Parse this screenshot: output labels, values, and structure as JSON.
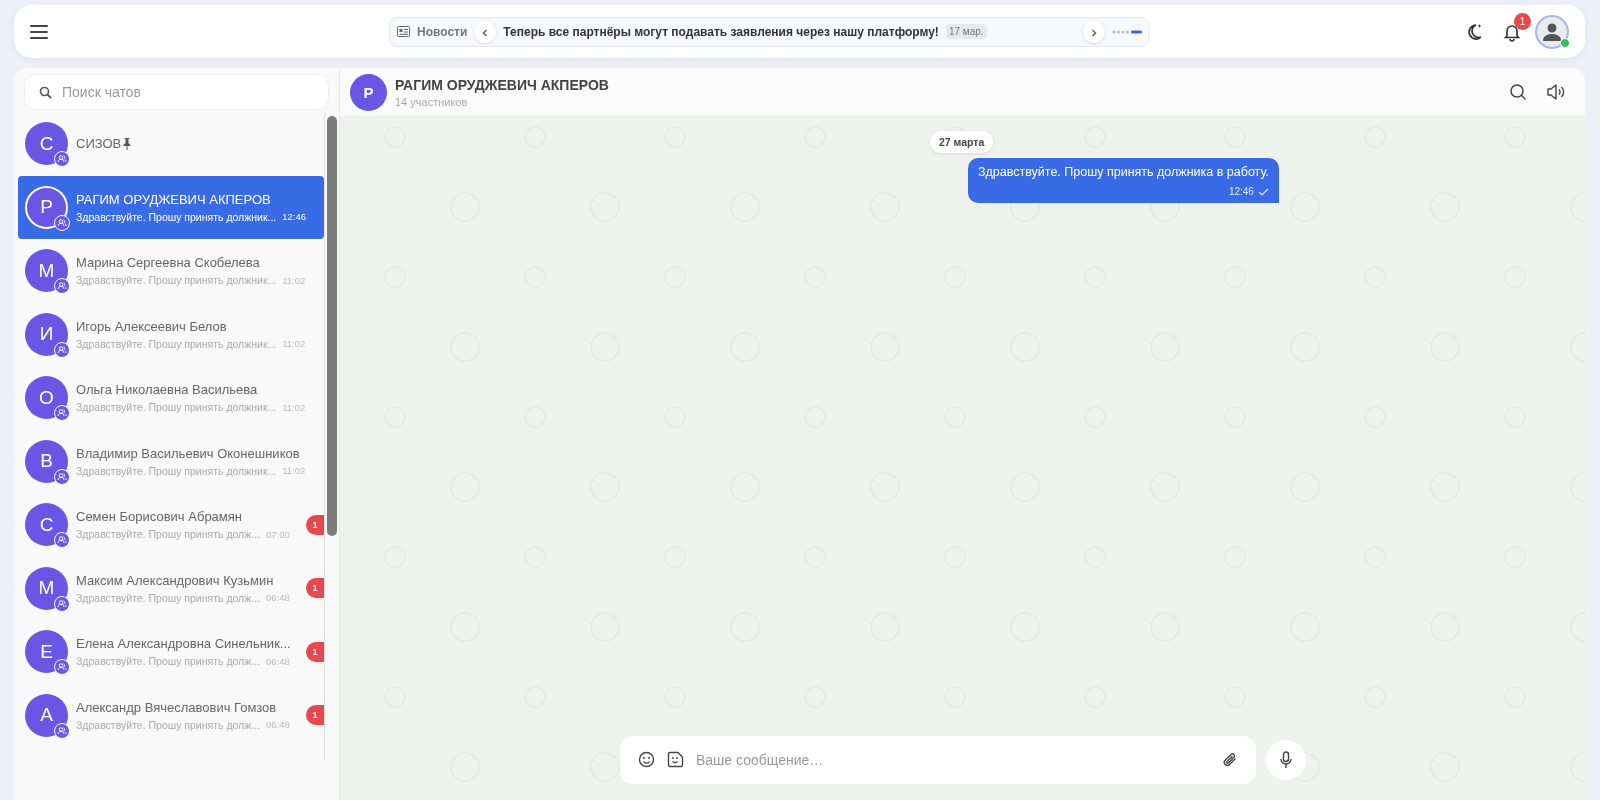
{
  "header": {
    "news_label": "Новости",
    "news_text": "Теперь все партнёры могут подавать заявления через нашу платформу!",
    "news_date": "17 мар.",
    "notifications": "1",
    "online": true
  },
  "search": {
    "placeholder": "Поиск чатов"
  },
  "chats": [
    {
      "initial": "С",
      "name": "СИЗОВ",
      "pinned": true,
      "selected": false
    },
    {
      "initial": "Р",
      "name": "РАГИМ ОРУДЖЕВИЧ АКПЕРОВ",
      "pinned": false,
      "preview": "Здравствуйте. Прошу принять должник...",
      "time": "12:46",
      "selected": true
    },
    {
      "initial": "М",
      "name": "Марина Сергеевна Скобелева",
      "pinned": false,
      "preview": "Здравствуйте. Прошу принять должник...",
      "time": "11:02",
      "selected": false
    },
    {
      "initial": "И",
      "name": "Игорь Алексеевич Белов",
      "pinned": false,
      "preview": "Здравствуйте. Прошу принять должник...",
      "time": "11:02",
      "selected": false
    },
    {
      "initial": "О",
      "name": "Ольга Николаевна Васильева",
      "pinned": false,
      "preview": "Здравствуйте. Прошу принять должник...",
      "time": "11:02",
      "selected": false
    },
    {
      "initial": "В",
      "name": "Владимир Васильевич Оконешников",
      "pinned": false,
      "preview": "Здравствуйте. Прошу принять должник...",
      "time": "11:02",
      "selected": false
    },
    {
      "initial": "С",
      "name": "Семен Борисович Абрамян",
      "pinned": false,
      "preview": "Здравствуйте. Прошу принять долж...",
      "time": "07:00",
      "unread": "1",
      "selected": false
    },
    {
      "initial": "М",
      "name": "Максим Александрович Кузьмин",
      "pinned": false,
      "preview": "Здравствуйте. Прошу принять долж...",
      "time": "06:48",
      "unread": "1",
      "selected": false
    },
    {
      "initial": "Е",
      "name": "Елена Александровна Синельник...",
      "pinned": false,
      "preview": "Здравствуйте. Прошу принять долж...",
      "time": "06:48",
      "unread": "1",
      "selected": false
    },
    {
      "initial": "А",
      "name": "Александр Вячеславович Гомзов",
      "pinned": false,
      "preview": "Здравствуйте. Прошу принять долж...",
      "time": "06:48",
      "unread": "1",
      "selected": false
    }
  ],
  "chat": {
    "initial": "Р",
    "title": "РАГИМ ОРУДЖЕВИЧ АКПЕРОВ",
    "subtitle": "14 участников",
    "messages": [
      {
        "kind": "date",
        "text": "27 марта"
      },
      {
        "kind": "outgoing",
        "text": "Здравствуйте. Прошу принять должника в работу.",
        "time": "12:46",
        "read": true
      }
    ],
    "input": {
      "placeholder": "Ваше сообщение…"
    }
  }
}
